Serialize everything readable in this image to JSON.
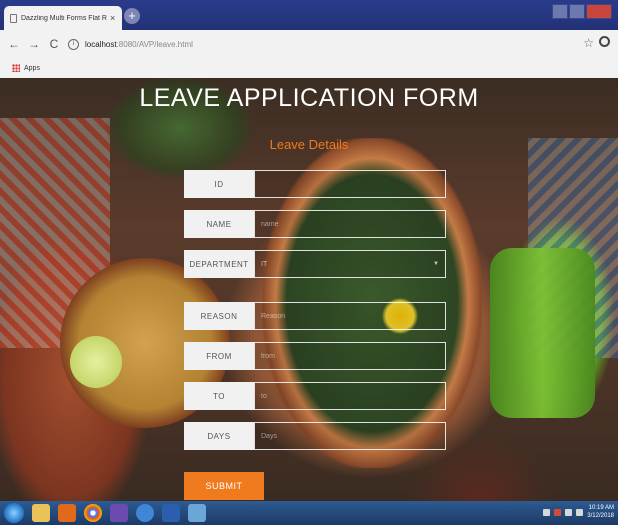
{
  "browser": {
    "tab_title": "Dazzling Multi Forms Flat Respo",
    "tab_close": "×",
    "new_tab": "+",
    "nav": {
      "back": "←",
      "forward": "→",
      "reload": "C"
    },
    "url_host": "localhost",
    "url_path": ":8080/AVP/leave.html",
    "bookmark_apps": "Apps"
  },
  "page": {
    "title": "LEAVE APPLICATION FORM",
    "subtitle": "Leave Details",
    "fields": [
      {
        "label": "ID",
        "value": "",
        "placeholder": ""
      },
      {
        "label": "NAME",
        "value": "",
        "placeholder": "name"
      },
      {
        "label": "DEPARTMENT",
        "value": "IT",
        "placeholder": ""
      },
      {
        "label": "REASON",
        "value": "",
        "placeholder": "Reason"
      },
      {
        "label": "FROM",
        "value": "",
        "placeholder": "from"
      },
      {
        "label": "TO",
        "value": "",
        "placeholder": "to"
      },
      {
        "label": "DAYS",
        "value": "",
        "placeholder": "Days"
      }
    ],
    "submit_label": "SUBMIT"
  },
  "taskbar": {
    "clock_time": "10:19 AM",
    "clock_date": "3/12/2018"
  },
  "colors": {
    "accent": "#f07a1e",
    "titlebar": "#2a3b8c",
    "taskbar": "#1c3a66"
  }
}
